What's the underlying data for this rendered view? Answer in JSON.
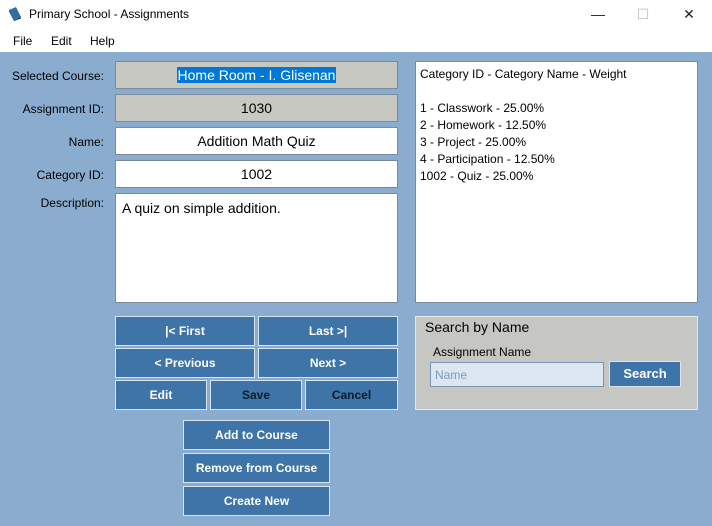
{
  "window": {
    "title": "Primary School - Assignments",
    "minimize": "—",
    "maximize": "☐",
    "close": "✕"
  },
  "menu": {
    "file": "File",
    "edit": "Edit",
    "help": "Help"
  },
  "form": {
    "selected_course_label": "Selected Course:",
    "selected_course_value": "Home Room - I. Glisenan",
    "assignment_id_label": "Assignment ID:",
    "assignment_id_value": "1030",
    "name_label": "Name:",
    "name_value": "Addition Math Quiz",
    "category_id_label": "Category ID:",
    "category_id_value": "1002",
    "description_label": "Description:",
    "description_value": "A quiz on simple addition."
  },
  "categories": {
    "header": "Category ID - Category Name - Weight",
    "rows": [
      "1 - Classwork - 25.00%",
      "2 - Homework - 12.50%",
      "3 - Project - 25.00%",
      "4 - Participation - 12.50%",
      "1002 - Quiz - 25.00%"
    ]
  },
  "nav": {
    "first": "|< First",
    "last": "Last >|",
    "previous": "< Previous",
    "next": "Next >",
    "edit": "Edit",
    "save": "Save",
    "cancel": "Cancel"
  },
  "actions": {
    "add_to_course": "Add to Course",
    "remove_from_course": "Remove from Course",
    "create_new": "Create New"
  },
  "search": {
    "group_title": "Search by Name",
    "label": "Assignment Name",
    "placeholder": "Name",
    "button": "Search"
  },
  "colors": {
    "background": "#8aadcf",
    "button": "#3e74a8",
    "readonly_field": "#c8c8c3",
    "selection": "#0078d7"
  }
}
